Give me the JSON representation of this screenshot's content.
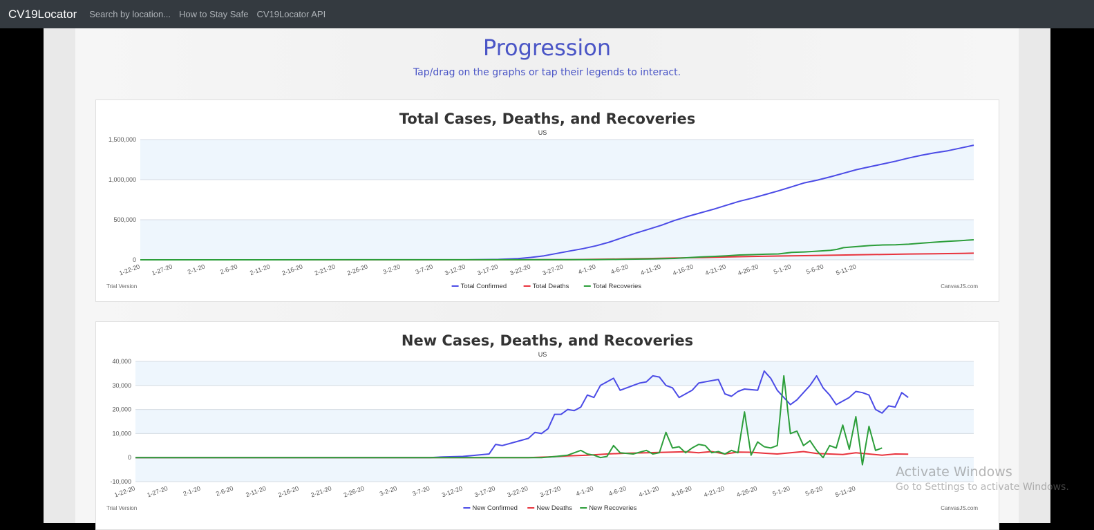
{
  "navbar": {
    "brand": "CV19Locator",
    "links": [
      "Search by location...",
      "How to Stay Safe",
      "CV19Locator API"
    ]
  },
  "page": {
    "title": "Progression",
    "subtitle": "Tap/drag on the graphs or tap their legends to interact."
  },
  "colors": {
    "confirmed": "#4b4be6",
    "deaths": "#e8333d",
    "recoveries": "#2c9e3a",
    "band": "#eef6fd",
    "grid": "#d4dbe3"
  },
  "watermark": {
    "line1": "Activate Windows",
    "line2": "Go to Settings to activate Windows."
  },
  "chart_data": [
    {
      "type": "line",
      "title": "Total Cases, Deaths, and Recoveries",
      "subtitle": "US",
      "trial_label": "Trial Version",
      "credit": "CanvasJS.com",
      "ylim": [
        0,
        1500000
      ],
      "y_ticks": [
        "0",
        "500,000",
        "1,000,000",
        "1,500,000"
      ],
      "x_labels": [
        "1-22-20",
        "1-27-20",
        "2-1-20",
        "2-6-20",
        "2-11-20",
        "2-16-20",
        "2-21-20",
        "2-26-20",
        "3-2-20",
        "3-7-20",
        "3-12-20",
        "3-17-20",
        "3-22-20",
        "3-27-20",
        "4-1-20",
        "4-6-20",
        "4-11-20",
        "4-16-20",
        "4-21-20",
        "4-26-20",
        "5-1-20",
        "5-6-20",
        "5-11-20"
      ],
      "grid": true,
      "legend_position": "bottom",
      "series": [
        {
          "name": "Total Confirmed",
          "key": "confirmed",
          "points": [
            [
              0,
              0
            ],
            [
              50,
              0
            ],
            [
              55,
              5000
            ],
            [
              58,
              15000
            ],
            [
              60,
              30000
            ],
            [
              62,
              50000
            ],
            [
              64,
              80000
            ],
            [
              66,
              110000
            ],
            [
              68,
              140000
            ],
            [
              70,
              175000
            ],
            [
              72,
              220000
            ],
            [
              74,
              275000
            ],
            [
              76,
              330000
            ],
            [
              78,
              380000
            ],
            [
              80,
              430000
            ],
            [
              82,
              490000
            ],
            [
              84,
              540000
            ],
            [
              86,
              585000
            ],
            [
              88,
              630000
            ],
            [
              90,
              680000
            ],
            [
              92,
              730000
            ],
            [
              94,
              770000
            ],
            [
              96,
              815000
            ],
            [
              98,
              860000
            ],
            [
              100,
              910000
            ],
            [
              102,
              960000
            ],
            [
              104,
              995000
            ],
            [
              106,
              1035000
            ],
            [
              108,
              1080000
            ],
            [
              110,
              1125000
            ],
            [
              112,
              1160000
            ],
            [
              114,
              1195000
            ],
            [
              116,
              1230000
            ],
            [
              118,
              1270000
            ],
            [
              120,
              1305000
            ],
            [
              122,
              1335000
            ],
            [
              124,
              1360000
            ],
            [
              126,
              1395000
            ],
            [
              128,
              1430000
            ]
          ]
        },
        {
          "name": "Total Deaths",
          "key": "deaths",
          "points": [
            [
              0,
              0
            ],
            [
              58,
              0
            ],
            [
              62,
              1500
            ],
            [
              66,
              3000
            ],
            [
              70,
              6000
            ],
            [
              74,
              10000
            ],
            [
              78,
              16000
            ],
            [
              82,
              22000
            ],
            [
              86,
              28000
            ],
            [
              90,
              35000
            ],
            [
              94,
              42000
            ],
            [
              98,
              47000
            ],
            [
              102,
              52000
            ],
            [
              106,
              57000
            ],
            [
              110,
              62000
            ],
            [
              114,
              67000
            ],
            [
              118,
              72000
            ],
            [
              122,
              76000
            ],
            [
              126,
              80000
            ],
            [
              128,
              83000
            ]
          ]
        },
        {
          "name": "Total Recoveries",
          "key": "recoveries",
          "points": [
            [
              0,
              0
            ],
            [
              70,
              2000
            ],
            [
              74,
              6000
            ],
            [
              78,
              10000
            ],
            [
              82,
              17000
            ],
            [
              86,
              35000
            ],
            [
              88,
              42000
            ],
            [
              90,
              50000
            ],
            [
              92,
              60000
            ],
            [
              94,
              65000
            ],
            [
              96,
              70000
            ],
            [
              98,
              73000
            ],
            [
              100,
              92000
            ],
            [
              102,
              98000
            ],
            [
              104,
              108000
            ],
            [
              106,
              118000
            ],
            [
              107,
              130000
            ],
            [
              108,
              152000
            ],
            [
              110,
              165000
            ],
            [
              112,
              178000
            ],
            [
              114,
              185000
            ],
            [
              116,
              188000
            ],
            [
              118,
              195000
            ],
            [
              120,
              208000
            ],
            [
              122,
              220000
            ],
            [
              124,
              230000
            ],
            [
              126,
              240000
            ],
            [
              128,
              250000
            ]
          ]
        }
      ]
    },
    {
      "type": "line",
      "title": "New Cases, Deaths, and Recoveries",
      "subtitle": "US",
      "trial_label": "Trial Version",
      "credit": "CanvasJS.com",
      "ylim": [
        -10000,
        40000
      ],
      "y_ticks": [
        "-10,000",
        "0",
        "10,000",
        "20,000",
        "30,000",
        "40,000"
      ],
      "x_labels": [
        "1-22-20",
        "1-27-20",
        "2-1-20",
        "2-6-20",
        "2-11-20",
        "2-16-20",
        "2-21-20",
        "2-26-20",
        "3-2-20",
        "3-7-20",
        "3-12-20",
        "3-17-20",
        "3-22-20",
        "3-27-20",
        "4-1-20",
        "4-6-20",
        "4-11-20",
        "4-16-20",
        "4-21-20",
        "4-26-20",
        "5-1-20",
        "5-6-20",
        "5-11-20"
      ],
      "grid": true,
      "legend_position": "bottom",
      "series": [
        {
          "name": "New Confirmed",
          "key": "confirmed",
          "points": [
            [
              0,
              0
            ],
            [
              45,
              0
            ],
            [
              47,
              300
            ],
            [
              50,
              500
            ],
            [
              52,
              1000
            ],
            [
              54,
              1500
            ],
            [
              55,
              5500
            ],
            [
              56,
              5000
            ],
            [
              58,
              6500
            ],
            [
              60,
              8000
            ],
            [
              61,
              10500
            ],
            [
              62,
              10000
            ],
            [
              63,
              12000
            ],
            [
              64,
              18000
            ],
            [
              65,
              18000
            ],
            [
              66,
              20000
            ],
            [
              67,
              19500
            ],
            [
              68,
              21000
            ],
            [
              69,
              26000
            ],
            [
              70,
              25000
            ],
            [
              71,
              30000
            ],
            [
              73,
              33000
            ],
            [
              74,
              28000
            ],
            [
              76,
              30000
            ],
            [
              77,
              31000
            ],
            [
              78,
              31500
            ],
            [
              79,
              34000
            ],
            [
              80,
              33500
            ],
            [
              81,
              30000
            ],
            [
              82,
              29000
            ],
            [
              83,
              25000
            ],
            [
              85,
              28000
            ],
            [
              86,
              31000
            ],
            [
              88,
              32000
            ],
            [
              89,
              32500
            ],
            [
              90,
              26500
            ],
            [
              91,
              25500
            ],
            [
              92,
              27500
            ],
            [
              93,
              28500
            ],
            [
              95,
              28000
            ],
            [
              96,
              36000
            ],
            [
              97,
              33000
            ],
            [
              98,
              28000
            ],
            [
              100,
              22000
            ],
            [
              101,
              24000
            ],
            [
              102,
              27000
            ],
            [
              103,
              30000
            ],
            [
              104,
              34000
            ],
            [
              105,
              29000
            ],
            [
              106,
              26000
            ],
            [
              107,
              22000
            ],
            [
              109,
              25000
            ],
            [
              110,
              27500
            ],
            [
              111,
              27000
            ],
            [
              112,
              26000
            ],
            [
              113,
              20000
            ],
            [
              114,
              18500
            ],
            [
              115,
              21500
            ],
            [
              116,
              21000
            ],
            [
              117,
              27000
            ],
            [
              118,
              25000
            ]
          ]
        },
        {
          "name": "New Deaths",
          "key": "deaths",
          "points": [
            [
              0,
              0
            ],
            [
              60,
              0
            ],
            [
              63,
              300
            ],
            [
              66,
              700
            ],
            [
              69,
              1000
            ],
            [
              72,
              1500
            ],
            [
              75,
              1800
            ],
            [
              78,
              2000
            ],
            [
              81,
              2200
            ],
            [
              84,
              2400
            ],
            [
              86,
              2000
            ],
            [
              88,
              2500
            ],
            [
              90,
              1500
            ],
            [
              92,
              2300
            ],
            [
              94,
              2200
            ],
            [
              96,
              1800
            ],
            [
              98,
              1500
            ],
            [
              100,
              2000
            ],
            [
              102,
              2500
            ],
            [
              104,
              1700
            ],
            [
              106,
              1500
            ],
            [
              108,
              1300
            ],
            [
              110,
              2000
            ],
            [
              112,
              1500
            ],
            [
              114,
              1000
            ],
            [
              116,
              1500
            ],
            [
              118,
              1400
            ]
          ]
        },
        {
          "name": "New Recoveries",
          "key": "recoveries",
          "points": [
            [
              0,
              0
            ],
            [
              62,
              0
            ],
            [
              64,
              400
            ],
            [
              66,
              1000
            ],
            [
              68,
              3000
            ],
            [
              69,
              1500
            ],
            [
              70,
              1000
            ],
            [
              71,
              0
            ],
            [
              72,
              500
            ],
            [
              73,
              5000
            ],
            [
              74,
              2000
            ],
            [
              76,
              1500
            ],
            [
              78,
              3000
            ],
            [
              79,
              1500
            ],
            [
              80,
              2000
            ],
            [
              81,
              10500
            ],
            [
              82,
              4000
            ],
            [
              83,
              4500
            ],
            [
              84,
              2000
            ],
            [
              85,
              4000
            ],
            [
              86,
              5500
            ],
            [
              87,
              5000
            ],
            [
              88,
              2000
            ],
            [
              89,
              2500
            ],
            [
              90,
              1500
            ],
            [
              91,
              3000
            ],
            [
              92,
              2000
            ],
            [
              93,
              19000
            ],
            [
              94,
              1000
            ],
            [
              95,
              6500
            ],
            [
              96,
              4500
            ],
            [
              97,
              4000
            ],
            [
              98,
              5000
            ],
            [
              99,
              34000
            ],
            [
              100,
              10000
            ],
            [
              101,
              11000
            ],
            [
              102,
              5000
            ],
            [
              103,
              7000
            ],
            [
              104,
              3000
            ],
            [
              105,
              0
            ],
            [
              106,
              5000
            ],
            [
              107,
              4000
            ],
            [
              108,
              13500
            ],
            [
              109,
              3500
            ],
            [
              110,
              17000
            ],
            [
              111,
              -3000
            ],
            [
              112,
              13000
            ],
            [
              113,
              3000
            ],
            [
              114,
              4000
            ]
          ]
        }
      ]
    }
  ]
}
